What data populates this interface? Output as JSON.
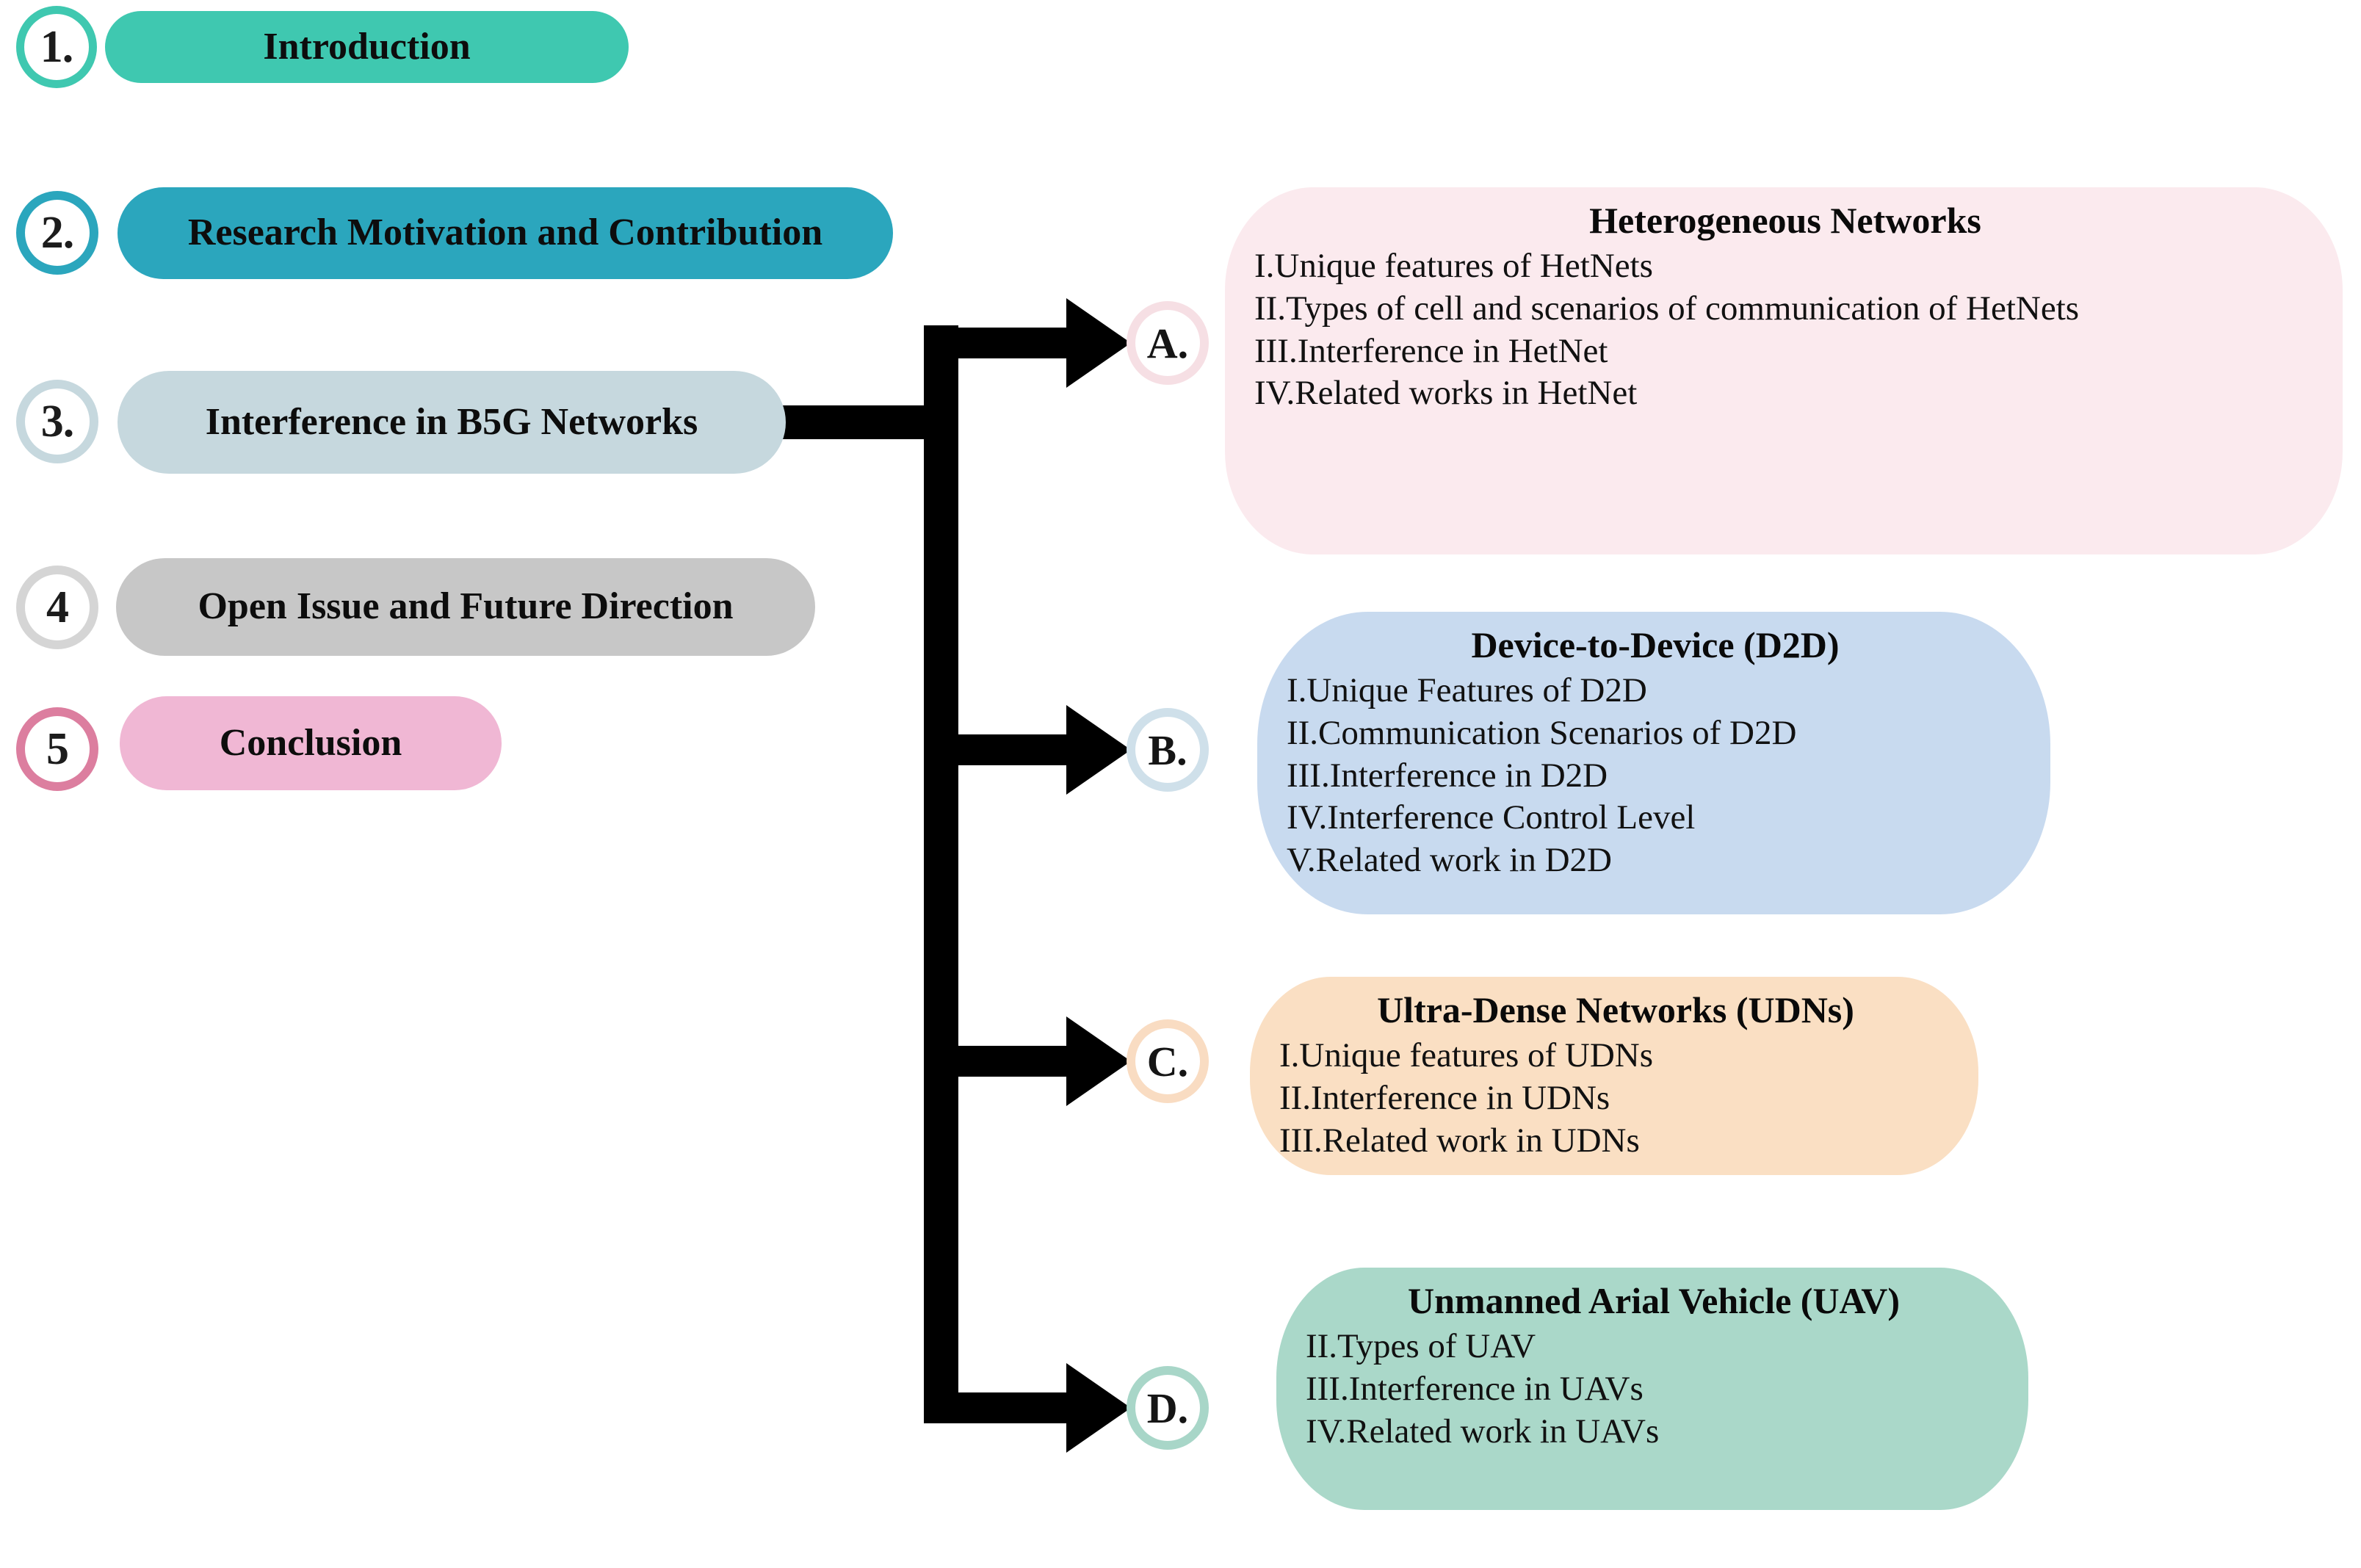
{
  "diagram": {
    "title": "Survey organization flow diagram",
    "sections": [
      {
        "number": "1.",
        "label": "Introduction",
        "pill_color": "#3fc8b0",
        "ring_color": "#3fc8b0",
        "text_color": "#0d0d0d"
      },
      {
        "number": "2.",
        "label": "Research Motivation and Contribution",
        "pill_color": "#2ba6bd",
        "ring_color": "#2ba6bd",
        "text_color": "#0d0d0d"
      },
      {
        "number": "3.",
        "label": "Interference in B5G Networks",
        "pill_color": "#c6d8de",
        "ring_color": "#c6d8de",
        "text_color": "#0d0d0d"
      },
      {
        "number": "4",
        "label": "Open Issue and Future Direction",
        "pill_color": "#c7c7c7",
        "ring_color": "#d5d5d5",
        "text_color": "#0d0d0d"
      },
      {
        "number": "5",
        "label": "Conclusion",
        "pill_color": "#f0b7d4",
        "ring_color": "#dc7e9f",
        "text_color": "#0d0d0d"
      }
    ],
    "branches": [
      {
        "letter": "A.",
        "title": "Heterogeneous Networks",
        "ring_color": "#f6dfe4",
        "panel_color": "#fbeaee",
        "items": [
          "I.Unique features of HetNets",
          "II.Types of cell and scenarios of communication of HetNets",
          "III.Interference in HetNet",
          "IV.Related works in HetNet"
        ]
      },
      {
        "letter": "B.",
        "title": "Device-to-Device (D2D)",
        "ring_color": "#cfe0ea",
        "panel_color": "#c8daef",
        "items": [
          "I.Unique Features of D2D",
          "II.Communication Scenarios of D2D",
          "III.Interference in D2D",
          "IV.Interference Control Level",
          "V.Related work in D2D"
        ]
      },
      {
        "letter": "C.",
        "title": "Ultra-Dense Networks (UDNs)",
        "ring_color": "#f9dcc2",
        "panel_color": "#fadfc3",
        "items": [
          "I.Unique features of UDNs",
          "II.Interference in UDNs",
          "III.Related work in UDNs"
        ]
      },
      {
        "letter": "D.",
        "title": "Unmanned Arial Vehicle (UAV)",
        "ring_color": "#a8d6c8",
        "panel_color": "#aad8c9",
        "items": [
          "II.Types of UAV",
          "III.Interference in UAVs",
          "IV.Related work in UAVs"
        ]
      }
    ],
    "connector": {
      "color": "#000000",
      "source_section_index": 3,
      "arrow_count": 4
    }
  }
}
